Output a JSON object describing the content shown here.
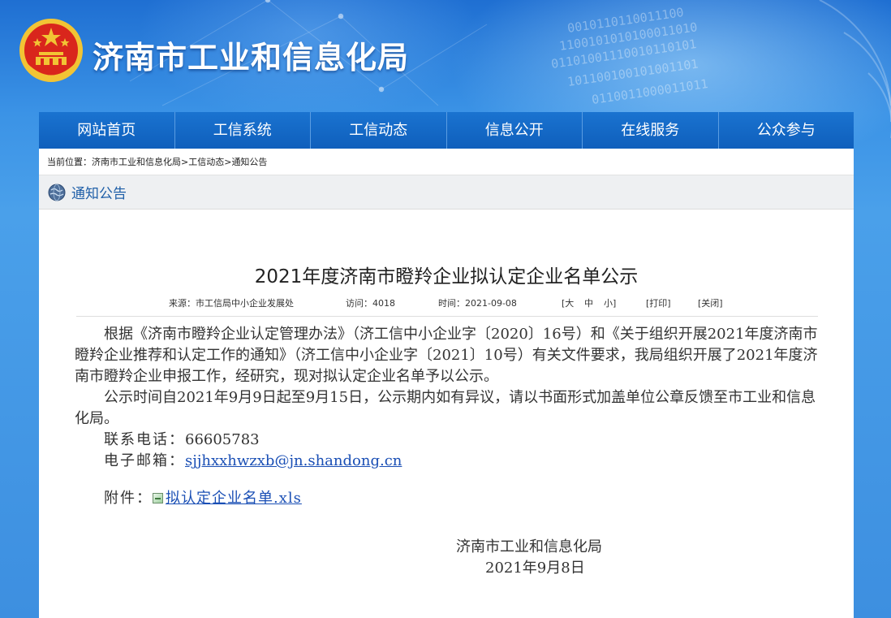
{
  "header": {
    "site_title": "济南市工业和信息化局",
    "emblem": "national-emblem"
  },
  "nav": {
    "items": [
      "网站首页",
      "工信系统",
      "工信动态",
      "信息公开",
      "在线服务",
      "公众参与"
    ]
  },
  "breadcrumb": {
    "label": "当前位置：",
    "items": [
      "济南市工业和信息化局",
      "工信动态",
      "通知公告"
    ],
    "separator": ">"
  },
  "section": {
    "title": "通知公告",
    "icon": "globe-icon"
  },
  "article": {
    "title": "2021年度济南市瞪羚企业拟认定企业名单公示",
    "meta": {
      "source": "来源：市工信局中小企业发展处",
      "visits": "访问：4018",
      "time": "时间：2021-09-08",
      "font_label_open": "[大",
      "font_mid": "中",
      "font_small": "小]",
      "print": "[打印]",
      "close": "[关闭]"
    },
    "paragraph1": "根据《济南市瞪羚企业认定管理办法》（济工信中小企业字〔2020〕16号）和《关于组织开展2021年度济南市瞪羚企业推荐和认定工作的通知》（济工信中小企业字〔2021〕10号）有关文件要求，我局组织开展了2021年度济南市瞪羚企业申报工作，经研究，现对拟认定企业名单予以公示。",
    "paragraph2": "公示时间自2021年9月9日起至9月15日，公示期内如有异议，请以书面形式加盖单位公章反馈至市工业和信息化局。",
    "phone_label": "联系电话：",
    "phone": "66605783",
    "email_label": "电子邮箱：",
    "email": "sjjhxxhwzxb@jn.shandong.cn",
    "attachment_label": "附件：",
    "attachment_name": "拟认定企业名单.xls",
    "attachment_icon": "xls-file-icon",
    "signature_org": "济南市工业和信息化局",
    "signature_date": "2021年9月8日"
  },
  "colors": {
    "nav_bg": "#0f5fbc",
    "link": "#1a4fb5",
    "section_title": "#1f5fa8"
  }
}
